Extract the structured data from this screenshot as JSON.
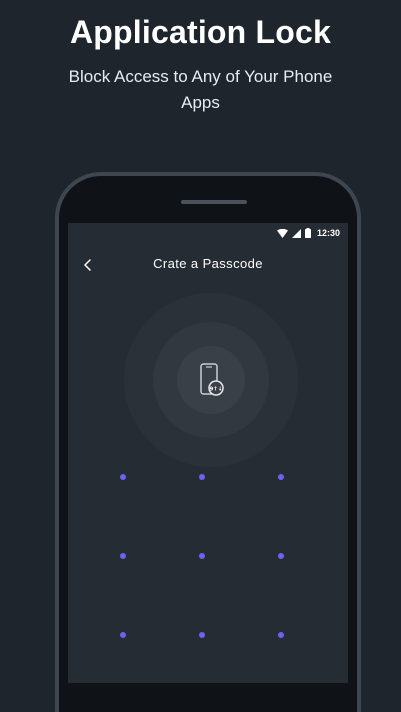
{
  "promo": {
    "title": "Application Lock",
    "subtitle": "Block Access to Any of Your Phone Apps"
  },
  "status_bar": {
    "time": "12:30",
    "icons": [
      "wifi-icon",
      "signal-icon",
      "battery-icon"
    ]
  },
  "screen": {
    "back_icon": "chevron-left-icon",
    "title": "Crate a Passcode",
    "center_icon": "phone-lock-icon",
    "badge_text": "9↑↓"
  },
  "pattern": {
    "dot_color": "#6a63f5",
    "rows": 3,
    "cols": 3
  },
  "colors": {
    "background": "#1e252d",
    "screen": "#262c33",
    "accent": "#6a63f5"
  }
}
